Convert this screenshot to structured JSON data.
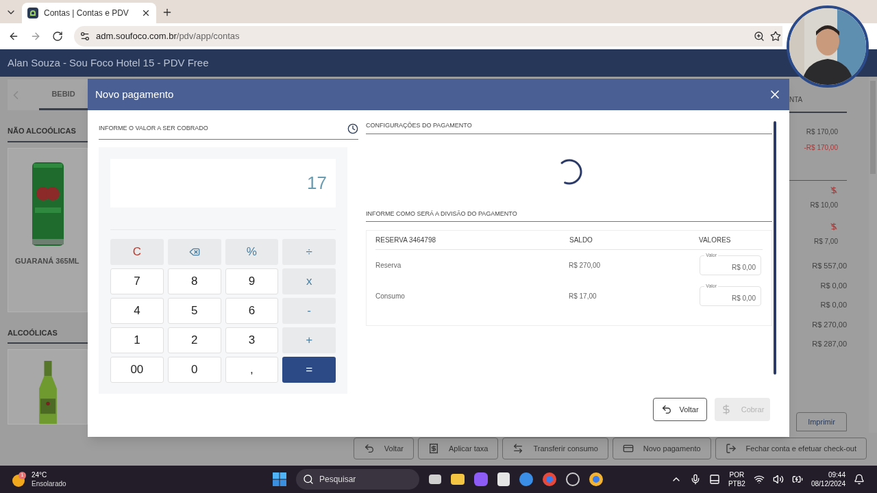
{
  "browser": {
    "tab_title": "Contas | Contas e PDV",
    "url_host": "adm.soufoco.com.br",
    "url_path": "/pdv/app/contas"
  },
  "app": {
    "header_title": "Alan Souza - Sou Foco Hotel 15 - PDV Free"
  },
  "background": {
    "left": {
      "tab_label": "BEBID",
      "sections": [
        {
          "title": "NÃO ALCOÓLICAS",
          "products": [
            {
              "kind": "can",
              "name": "GUARANÁ 365ML"
            }
          ]
        },
        {
          "title": "ALCOÓLICAS",
          "products": [
            {
              "kind": "bottle"
            }
          ]
        }
      ]
    },
    "right": {
      "tab_label": "NTA",
      "amounts": [
        {
          "value": "R$ 170,00",
          "negative": false
        },
        {
          "value": "-R$ 170,00",
          "negative": true
        }
      ],
      "items": [
        {
          "value": "R$ 10,00"
        },
        {
          "value": "R$ 7,00"
        }
      ],
      "totals": [
        "R$ 557,00",
        "R$ 0,00",
        "R$ 0,00",
        "R$ 270,00",
        "R$ 287,00"
      ],
      "print_button": "Imprimir"
    },
    "actions": [
      {
        "kind": "back",
        "label": "Voltar"
      },
      {
        "kind": "fee",
        "label": "Aplicar taxa"
      },
      {
        "kind": "transfer",
        "label": "Transferir consumo"
      },
      {
        "kind": "payment",
        "label": "Novo pagamento"
      },
      {
        "kind": "checkout",
        "label": "Fechar conta e efetuar check-out"
      }
    ]
  },
  "modal": {
    "title": "Novo pagamento",
    "amount_title": "INFORME O VALOR A SER COBRADO",
    "display": "17",
    "keys": [
      {
        "kind": "clear",
        "label": "C"
      },
      {
        "kind": "backspace"
      },
      {
        "kind": "operator",
        "label": "%"
      },
      {
        "kind": "operator",
        "label": "÷"
      },
      {
        "kind": "digit",
        "label": "7"
      },
      {
        "kind": "digit",
        "label": "8"
      },
      {
        "kind": "digit",
        "label": "9"
      },
      {
        "kind": "operator",
        "label": "x"
      },
      {
        "kind": "digit",
        "label": "4"
      },
      {
        "kind": "digit",
        "label": "5"
      },
      {
        "kind": "digit",
        "label": "6"
      },
      {
        "kind": "operator",
        "label": "-"
      },
      {
        "kind": "digit",
        "label": "1"
      },
      {
        "kind": "digit",
        "label": "2"
      },
      {
        "kind": "digit",
        "label": "3"
      },
      {
        "kind": "operator",
        "label": "+"
      },
      {
        "kind": "digit",
        "label": "00"
      },
      {
        "kind": "digit",
        "label": "0"
      },
      {
        "kind": "digit",
        "label": ","
      },
      {
        "kind": "equals",
        "label": "="
      }
    ],
    "config_title": "CONFIGURAÇÕES DO PAGAMENTO",
    "loading": true,
    "split_title": "INFORME COMO SERÁ A DIVISÃO DO PAGAMENTO",
    "columns": [
      "RESERVA 3464798",
      "SALDO",
      "VALORES"
    ],
    "rows": [
      {
        "label": "Reserva",
        "balance": "R$ 270,00",
        "field_label": "Valor",
        "field_value": "R$ 0,00"
      },
      {
        "label": "Consumo",
        "balance": "R$ 17,00",
        "field_label": "Valor",
        "field_value": "R$ 0,00"
      }
    ],
    "back_button": {
      "label": "Voltar"
    },
    "charge_button": {
      "label": "Cobrar",
      "disabled": true
    }
  },
  "taskbar": {
    "weather": {
      "badge": "1",
      "temperature": "24°C",
      "condition": "Ensolarado"
    },
    "search_placeholder": "Pesquisar",
    "language": "POR",
    "layout": "PTB2",
    "time": "09:44",
    "date": "08/12/2024"
  }
}
